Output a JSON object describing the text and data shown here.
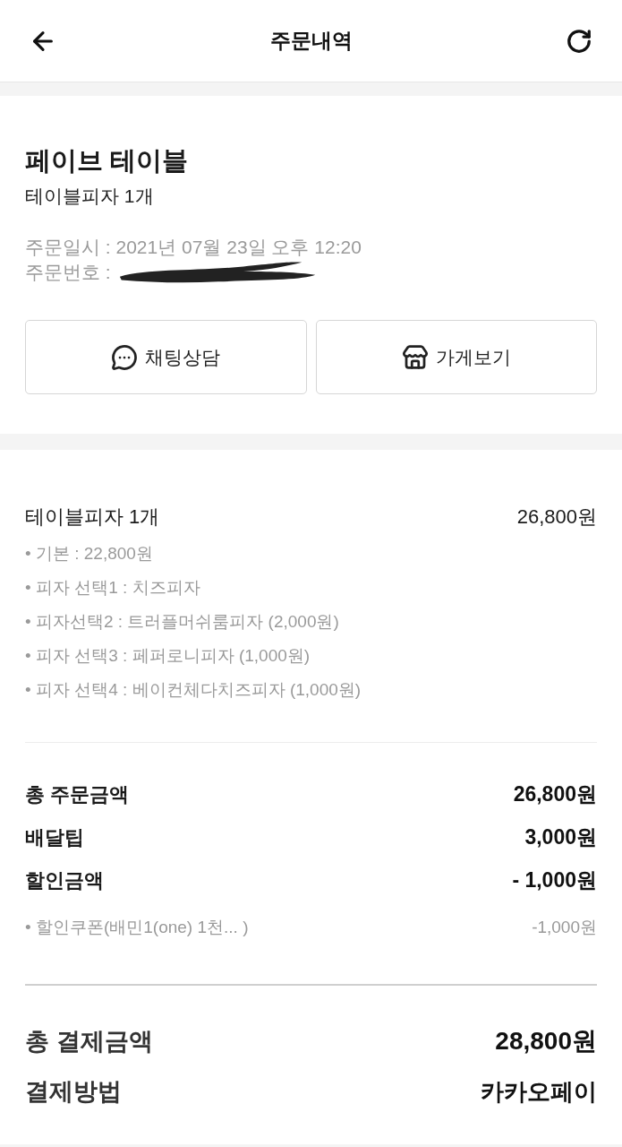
{
  "header": {
    "title": "주문내역"
  },
  "store": {
    "name": "페이브 테이블",
    "summary": "테이블피자 1개",
    "order_date": "주문일시 : 2021년 07월 23일 오후 12:20",
    "order_number": {
      "label": "주문번호 :",
      "redacted": true
    }
  },
  "actions": [
    {
      "kind": "chat",
      "label": "채팅상담"
    },
    {
      "kind": "store",
      "label": "가게보기"
    }
  ],
  "items": [
    {
      "name": "테이블피자 1개",
      "price": "26,800원",
      "options": [
        "• 기본 : 22,800원",
        "• 피자 선택1 : 치즈피자",
        "• 피자선택2 : 트러플머쉬룸피자 (2,000원)",
        "• 피자 선택3 : 페퍼로니피자 (1,000원)",
        "• 피자 선택4 : 베이컨체다치즈피자 (1,000원)"
      ]
    }
  ],
  "totals": [
    {
      "label": "총 주문금액",
      "value": "26,800원"
    },
    {
      "label": "배달팁",
      "value": "3,000원"
    },
    {
      "label": "할인금액",
      "value": "- 1,000원"
    }
  ],
  "discounts": [
    {
      "label": "• 할인쿠폰(배민1(one) 1천... )",
      "value": "-1,000원"
    }
  ],
  "payment": [
    {
      "kind": "amount",
      "label": "총 결제금액",
      "value": "28,800원"
    },
    {
      "kind": "method",
      "label": "결제방법",
      "value": "카카오페이"
    }
  ]
}
